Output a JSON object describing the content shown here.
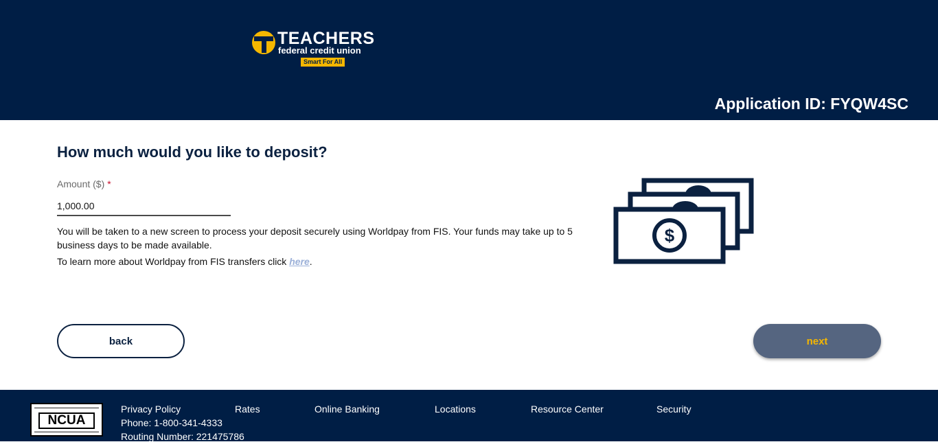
{
  "header": {
    "logo": {
      "title": "TEACHERS",
      "subtitle": "federal credit union",
      "tagline": "Smart For All"
    },
    "application_id": "Application ID: FYQW4SC"
  },
  "main": {
    "title": "How much would you like to deposit?",
    "amount_field": {
      "label": "Amount ($)",
      "required_marker": "*",
      "value": "1,000.00"
    },
    "description": "You will be taken to a new screen to process your deposit securely using Worldpay from FIS.  Your funds may take up to 5 business days to be made available.",
    "learn_more_prefix": "To learn more about Worldpay from FIS transfers click ",
    "learn_more_link": "here",
    "learn_more_suffix": ".",
    "illustration_icon": "money-bills-icon",
    "back_label": "back",
    "next_label": "next"
  },
  "footer": {
    "badge_text": "NCUA",
    "links": [
      "Privacy Policy",
      "Rates",
      "Online Banking",
      "Locations",
      "Resource Center",
      "Security"
    ],
    "phone": "Phone: 1-800-341-4333",
    "routing": "Routing Number: 221475786"
  },
  "colors": {
    "navy": "#001e45",
    "gold": "#f5b700",
    "next_button_bg": "#556580",
    "link": "#9bb0d8"
  }
}
